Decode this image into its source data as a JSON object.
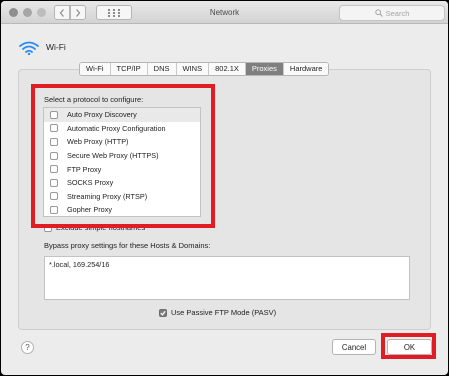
{
  "window": {
    "title": "Network"
  },
  "search": {
    "placeholder": "Search"
  },
  "interface": {
    "name": "Wi-Fi"
  },
  "tabs": [
    {
      "label": "Wi-Fi",
      "active": false
    },
    {
      "label": "TCP/IP",
      "active": false
    },
    {
      "label": "DNS",
      "active": false
    },
    {
      "label": "WINS",
      "active": false
    },
    {
      "label": "802.1X",
      "active": false
    },
    {
      "label": "Proxies",
      "active": true
    },
    {
      "label": "Hardware",
      "active": false
    }
  ],
  "proxies": {
    "select_title": "Select a protocol to configure:",
    "protocols": [
      {
        "label": "Auto Proxy Discovery",
        "checked": false,
        "selected": true
      },
      {
        "label": "Automatic Proxy Configuration",
        "checked": false,
        "selected": false
      },
      {
        "label": "Web Proxy (HTTP)",
        "checked": false,
        "selected": false
      },
      {
        "label": "Secure Web Proxy (HTTPS)",
        "checked": false,
        "selected": false
      },
      {
        "label": "FTP Proxy",
        "checked": false,
        "selected": false
      },
      {
        "label": "SOCKS Proxy",
        "checked": false,
        "selected": false
      },
      {
        "label": "Streaming Proxy (RTSP)",
        "checked": false,
        "selected": false
      },
      {
        "label": "Gopher Proxy",
        "checked": false,
        "selected": false
      }
    ],
    "exclude_simple_hostnames": {
      "label": "Exclude simple hostnames",
      "checked": false
    },
    "bypass_label": "Bypass proxy settings for these Hosts & Domains:",
    "bypass_value": "*.local, 169.254/16",
    "passive_ftp": {
      "label": "Use Passive FTP Mode (PASV)",
      "checked": true
    }
  },
  "buttons": {
    "help": "?",
    "cancel": "Cancel",
    "ok": "OK"
  },
  "colors": {
    "highlight": "#e01c24",
    "active_tab": "#7f7f7f",
    "wifi_icon": "#2a8cf0"
  }
}
